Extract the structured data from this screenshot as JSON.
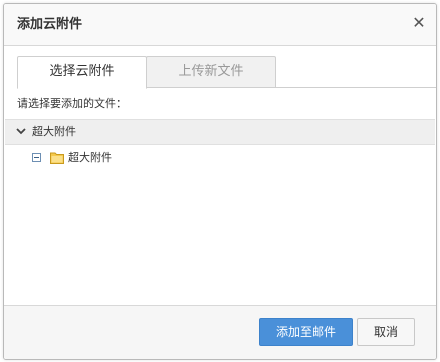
{
  "dialog": {
    "title": "添加云附件",
    "close_icon": "close-icon"
  },
  "tabs": [
    {
      "label": "选择云附件",
      "active": true
    },
    {
      "label": "上传新文件",
      "active": false
    }
  ],
  "prompt": "请选择要添加的文件：",
  "group": {
    "label": "超大附件",
    "expanded": true,
    "icon": "chevron-down-icon"
  },
  "tree": {
    "items": [
      {
        "label": "超大附件",
        "expander_icon": "collapse-minus-icon",
        "icon": "folder-icon"
      }
    ]
  },
  "footer": {
    "confirm_label": "添加至邮件",
    "cancel_label": "取消"
  },
  "colors": {
    "primary_button": "#4a90d9",
    "folder": "#f5c94c"
  }
}
